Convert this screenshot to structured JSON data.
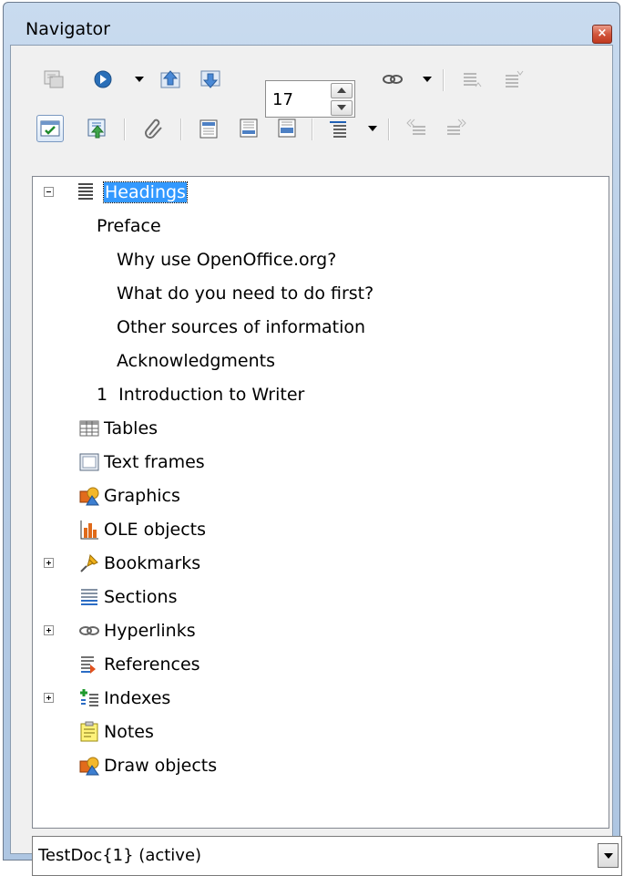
{
  "window": {
    "title": "Navigator",
    "close_glyph": "×"
  },
  "toolbar": {
    "page_number": "17"
  },
  "tree": {
    "items": [
      {
        "label": "Headings"
      },
      {
        "label": "Preface"
      },
      {
        "label": "Why use OpenOffice.org?"
      },
      {
        "label": "What do you need to do first?"
      },
      {
        "label": "Other sources of information"
      },
      {
        "label": "Acknowledgments"
      },
      {
        "label": "1  Introduction to Writer"
      },
      {
        "label": "Tables"
      },
      {
        "label": "Text frames"
      },
      {
        "label": "Graphics"
      },
      {
        "label": "OLE objects"
      },
      {
        "label": "Bookmarks"
      },
      {
        "label": "Sections"
      },
      {
        "label": "Hyperlinks"
      },
      {
        "label": "References"
      },
      {
        "label": "Indexes"
      },
      {
        "label": "Notes"
      },
      {
        "label": "Draw objects"
      }
    ]
  },
  "document_selector": {
    "selected": "TestDoc{1} (active)"
  },
  "colors": {
    "selection": "#3399ff",
    "title_bar": "#b7cde6",
    "close_button": "#c0391f"
  }
}
